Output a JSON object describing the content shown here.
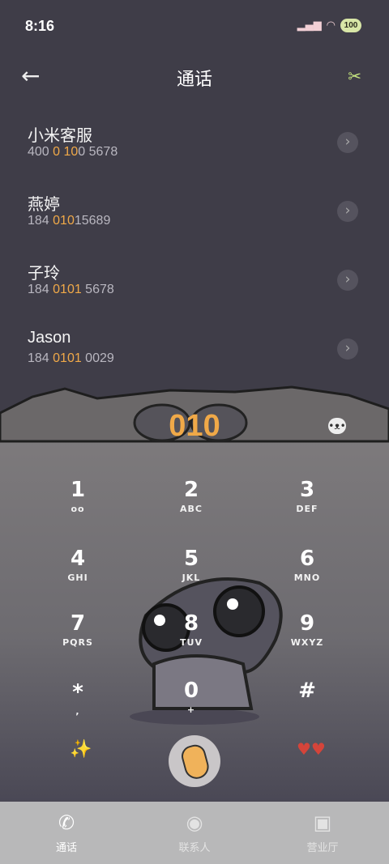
{
  "status": {
    "time": "8:16",
    "battery": "100"
  },
  "header": {
    "title": "通话",
    "back_icon": "arrow-left-icon",
    "tool_icon": "wrench-icon"
  },
  "contacts": [
    {
      "name": "小米客服",
      "num_pre": "400 ",
      "num_hl": "0 10",
      "num_post": "0 5678"
    },
    {
      "name": "燕婷",
      "num_pre": "184 ",
      "num_hl": "010",
      "num_post": "15689"
    },
    {
      "name": "子玲",
      "num_pre": "184 ",
      "num_hl": "0101",
      "num_post": " 5678"
    },
    {
      "name": "Jason",
      "num_pre": "184 ",
      "num_hl": "0101",
      "num_post": " 0029"
    }
  ],
  "dial": {
    "digits": "010"
  },
  "keypad": [
    {
      "digit": "1",
      "letters": "oo"
    },
    {
      "digit": "2",
      "letters": "ABC"
    },
    {
      "digit": "3",
      "letters": "DEF"
    },
    {
      "digit": "4",
      "letters": "GHI"
    },
    {
      "digit": "5",
      "letters": "JKL"
    },
    {
      "digit": "6",
      "letters": "MNO"
    },
    {
      "digit": "7",
      "letters": "PQRS"
    },
    {
      "digit": "8",
      "letters": "TUV"
    },
    {
      "digit": "9",
      "letters": "WXYZ"
    },
    {
      "digit": "*",
      "letters": ","
    },
    {
      "digit": "0",
      "letters": "+"
    },
    {
      "digit": "#",
      "letters": ""
    }
  ],
  "nav": [
    {
      "label": "通话",
      "icon": "phone-icon"
    },
    {
      "label": "联系人",
      "icon": "contact-icon"
    },
    {
      "label": "营业厅",
      "icon": "bag-icon"
    }
  ],
  "colors": {
    "accent": "#f0a948",
    "background": "#3f3d48"
  }
}
